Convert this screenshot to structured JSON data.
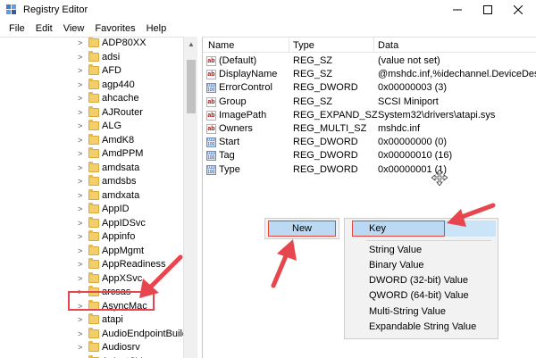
{
  "window": {
    "title": "Registry Editor"
  },
  "menu": [
    "File",
    "Edit",
    "View",
    "Favorites",
    "Help"
  ],
  "tree": {
    "items": [
      "ADP80XX",
      "adsi",
      "AFD",
      "agp440",
      "ahcache",
      "AJRouter",
      "ALG",
      "AmdK8",
      "AmdPPM",
      "amdsata",
      "amdsbs",
      "amdxata",
      "AppID",
      "AppIDSvc",
      "Appinfo",
      "AppMgmt",
      "AppReadiness",
      "AppXSvc",
      "arcsas",
      "AsyncMac",
      "atapi",
      "AudioEndpointBuilder",
      "Audiosrv",
      "AxInstSV"
    ],
    "selected": "atapi"
  },
  "values": {
    "headers": {
      "name": "Name",
      "type": "Type",
      "data": "Data"
    },
    "rows": [
      {
        "name": "(Default)",
        "type": "REG_SZ",
        "data": "(value not set)",
        "icon": "string-value-icon"
      },
      {
        "name": "DisplayName",
        "type": "REG_SZ",
        "data": "@mshdc.inf,%idechannel.DeviceDesc%;ID",
        "icon": "string-value-icon"
      },
      {
        "name": "ErrorControl",
        "type": "REG_DWORD",
        "data": "0x00000003 (3)",
        "icon": "binary-value-icon"
      },
      {
        "name": "Group",
        "type": "REG_SZ",
        "data": "SCSI Miniport",
        "icon": "string-value-icon"
      },
      {
        "name": "ImagePath",
        "type": "REG_EXPAND_SZ",
        "data": "System32\\drivers\\atapi.sys",
        "icon": "string-value-icon"
      },
      {
        "name": "Owners",
        "type": "REG_MULTI_SZ",
        "data": "mshdc.inf",
        "icon": "string-value-icon"
      },
      {
        "name": "Start",
        "type": "REG_DWORD",
        "data": "0x00000000 (0)",
        "icon": "binary-value-icon"
      },
      {
        "name": "Tag",
        "type": "REG_DWORD",
        "data": "0x00000010 (16)",
        "icon": "binary-value-icon"
      },
      {
        "name": "Type",
        "type": "REG_DWORD",
        "data": "0x00000001 (1)",
        "icon": "binary-value-icon"
      }
    ]
  },
  "context_menu": {
    "new_label": "New",
    "submenu": [
      "Key",
      "String Value",
      "Binary Value",
      "DWORD (32-bit) Value",
      "QWORD (64-bit) Value",
      "Multi-String Value",
      "Expandable String Value"
    ]
  },
  "colors": {
    "annotation_red": "#e8464e",
    "menu_highlight": "#bcd9f4",
    "folder": "#f3cf6b"
  }
}
